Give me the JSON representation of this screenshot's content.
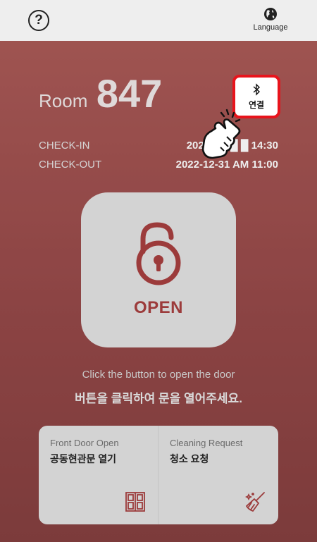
{
  "header": {
    "help_icon": "question-circle-icon",
    "help_symbol": "?",
    "language_icon": "globe-icon",
    "language_label": "Language"
  },
  "room": {
    "label": "Room",
    "number": "847"
  },
  "stay": {
    "checkin_label": "CHECK-IN",
    "checkin_value": "2021-0█-█ █ 14:30",
    "checkout_label": "CHECK-OUT",
    "checkout_value": "2022-12-31 AM 11:00"
  },
  "bluetooth": {
    "icon": "bluetooth-icon",
    "label": "연결",
    "highlight_color": "#e8141c"
  },
  "door": {
    "open_label": "OPEN",
    "lock_icon": "unlocked-padlock-icon",
    "accent_color": "#9c3b3b"
  },
  "hint": {
    "english": "Click the button to open the door",
    "korean": "버튼을 클릭하여 문을 열어주세요."
  },
  "actions": [
    {
      "sub": "Front Door Open",
      "main": "공동현관문 열기",
      "icon": "double-door-icon"
    },
    {
      "sub": "Cleaning Request",
      "main": "청소 요청",
      "icon": "cleaning-broom-icon"
    }
  ]
}
